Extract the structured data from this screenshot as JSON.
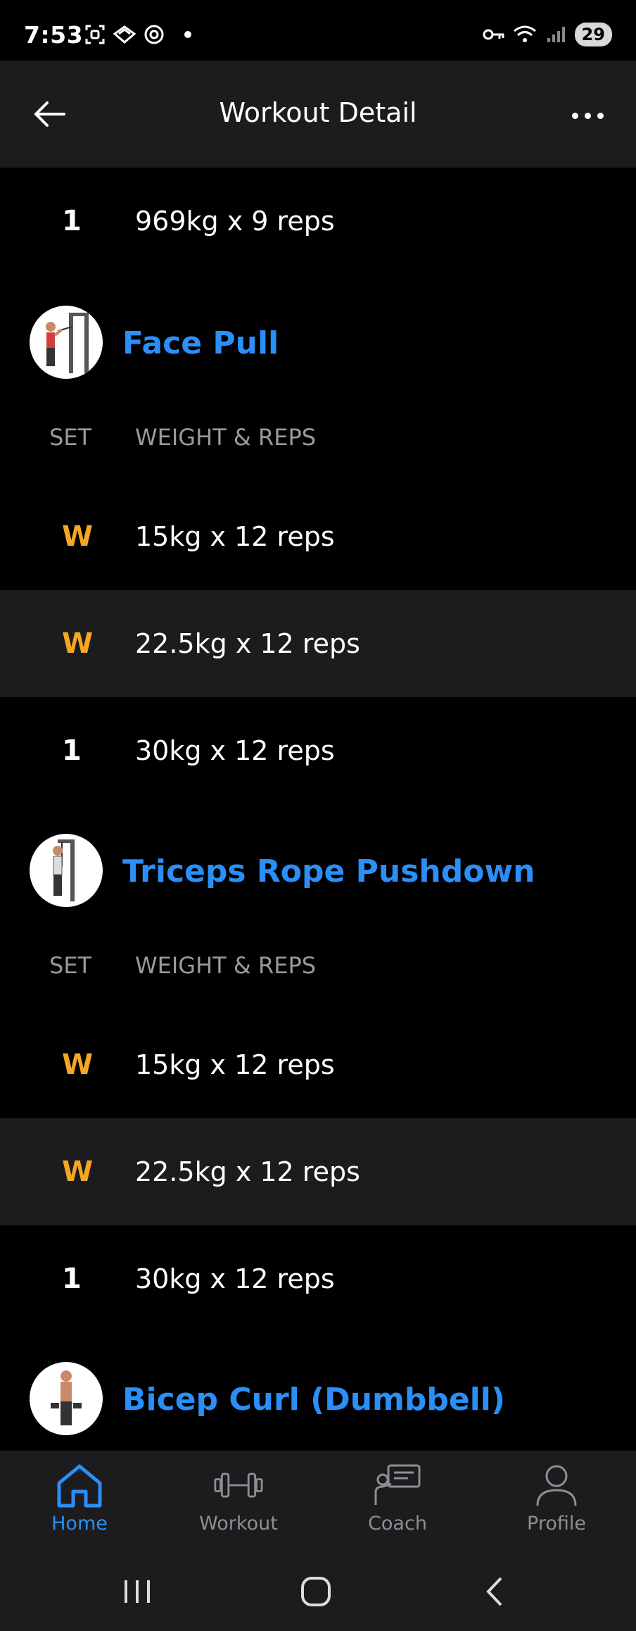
{
  "status_bar": {
    "time": "7:53",
    "battery": "29"
  },
  "header": {
    "title": "Workout Detail"
  },
  "top_set": {
    "set": "1",
    "text": "969kg x 9 reps"
  },
  "exercises": [
    {
      "name": "Face Pull",
      "columns": {
        "set": "SET",
        "weight_reps": "WEIGHT & REPS"
      },
      "sets": [
        {
          "set": "W",
          "text": "15kg x 12 reps"
        },
        {
          "set": "W",
          "text": "22.5kg x 12 reps"
        },
        {
          "set": "1",
          "text": "30kg x 12 reps"
        }
      ]
    },
    {
      "name": "Triceps Rope Pushdown",
      "columns": {
        "set": "SET",
        "weight_reps": "WEIGHT & REPS"
      },
      "sets": [
        {
          "set": "W",
          "text": "15kg x 12 reps"
        },
        {
          "set": "W",
          "text": "22.5kg x 12 reps"
        },
        {
          "set": "1",
          "text": "30kg x 12 reps"
        }
      ]
    },
    {
      "name": "Bicep Curl (Dumbbell)"
    }
  ],
  "bottom_nav": {
    "items": [
      {
        "label": "Home",
        "icon": "home-icon",
        "active": true
      },
      {
        "label": "Workout",
        "icon": "dumbbell-icon",
        "active": false
      },
      {
        "label": "Coach",
        "icon": "coach-icon",
        "active": false
      },
      {
        "label": "Profile",
        "icon": "profile-icon",
        "active": false
      }
    ]
  },
  "colors": {
    "accent": "#2a8ff7",
    "warmup": "#f5a623",
    "background": "#000000",
    "surface": "#1c1c1e"
  }
}
